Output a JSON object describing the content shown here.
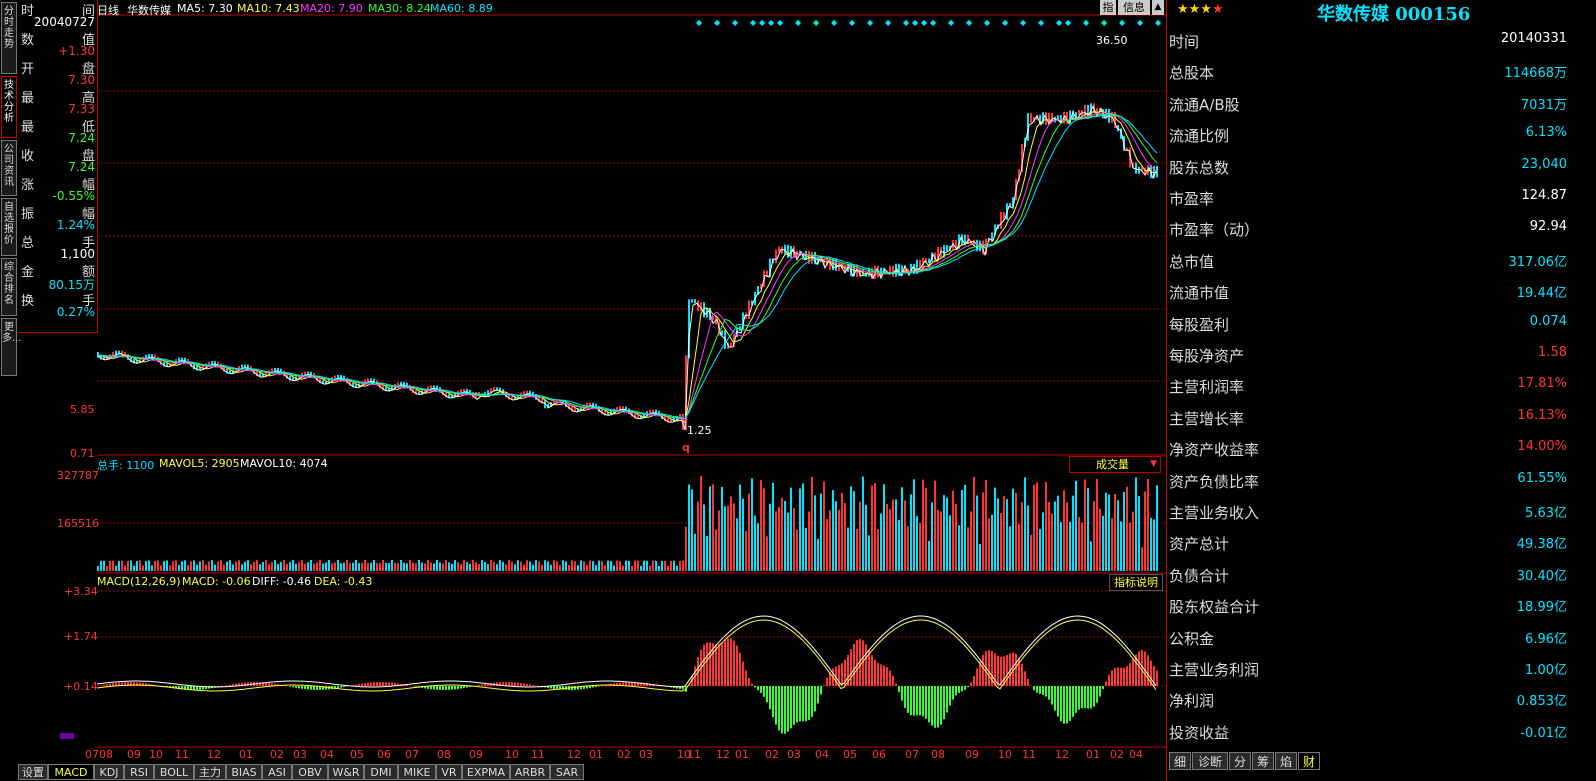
{
  "left_tabs": [
    "分时走势",
    "技术分析",
    "公司资讯",
    "自选报价",
    "综合排名",
    "更多..."
  ],
  "info": {
    "rows": [
      {
        "label": "时",
        "label2": "间",
        "value": "20040727",
        "color": "#ffffff"
      },
      {
        "label": "数",
        "label2": "值",
        "value": "+1.30",
        "color": "#ff3333"
      },
      {
        "label": "开",
        "label2": "盘",
        "value": "7.30",
        "color": "#ff3333"
      },
      {
        "label": "最",
        "label2": "高",
        "value": "7.33",
        "color": "#ff3333"
      },
      {
        "label": "最",
        "label2": "低",
        "value": "7.24",
        "color": "#33ff33"
      },
      {
        "label": "收",
        "label2": "盘",
        "value": "7.24",
        "color": "#33ff33"
      },
      {
        "label": "涨",
        "label2": "幅",
        "value": "-0.55%",
        "color": "#33ff33"
      },
      {
        "label": "振",
        "label2": "幅",
        "value": "1.24%",
        "color": "#00e5ff"
      },
      {
        "label": "总",
        "label2": "手",
        "value": "1,100",
        "color": "#ffffff"
      },
      {
        "label": "金",
        "label2": "额",
        "value": "80.15万",
        "color": "#00e5ff"
      },
      {
        "label": "换",
        "label2": "手",
        "value": "0.27%",
        "color": "#00e5ff"
      }
    ]
  },
  "header": {
    "period": "日线",
    "name": "华数传媒",
    "ma": [
      {
        "text": "MA5: 7.30",
        "color": "#ffffff"
      },
      {
        "text": "MA10: 7.43",
        "color": "#ffff33"
      },
      {
        "text": "MA20: 7.90",
        "color": "#ff33ff"
      },
      {
        "text": "MA30: 8.24",
        "color": "#33ff33"
      },
      {
        "text": "MA60: 8.89",
        "color": "#00e5ff"
      }
    ],
    "btn_ref": "指",
    "btn_info": "信息"
  },
  "price_axis": [
    "5.85",
    "0.71"
  ],
  "price_marks": {
    "high": "36.50",
    "low": "1.25",
    "q": "q"
  },
  "volume": {
    "label": "总手: 1100",
    "mavol5": "MAVOL5: 2905",
    "mavol10": "MAVOL10: 4074",
    "axis": [
      "327787",
      "165516"
    ],
    "select": "成交量"
  },
  "macd": {
    "label": "MACD(12,26,9)",
    "macd": "MACD: -0.06",
    "diff": "DIFF: -0.46",
    "dea": "DEA: -0.43",
    "axis": [
      "+3.34",
      "+1.74",
      "+0.14"
    ],
    "button": "指标说明"
  },
  "x_labels": [
    "07",
    "08",
    "09",
    "10",
    "11",
    "12",
    "01",
    "02",
    "03",
    "04",
    "05",
    "06",
    "07",
    "08",
    "09",
    "10",
    "11",
    "12",
    "01",
    "02",
    "03",
    "10",
    "11",
    "12",
    "01",
    "02",
    "03",
    "04",
    "05",
    "06",
    "07",
    "08",
    "09",
    "10",
    "11",
    "12",
    "01",
    "02",
    "04"
  ],
  "bottom_tabs": [
    "设置",
    "MACD",
    "KDJ",
    "RSI",
    "BOLL",
    "主力",
    "BIAS",
    "ASI",
    "OBV",
    "W&R",
    "DMI",
    "MIKE",
    "VR",
    "EXPMA",
    "ARBR",
    "SAR"
  ],
  "right": {
    "stars": "★★★",
    "star_red": "★",
    "title": "华数传媒 000156",
    "rows": [
      {
        "label": "时间",
        "value": "20140331",
        "color": "#ffffff"
      },
      {
        "label": "总股本",
        "value": "114668万",
        "color": "#00e5ff"
      },
      {
        "label": "流通A/B股",
        "value": "7031万",
        "color": "#00e5ff"
      },
      {
        "label": "流通比例",
        "value": "6.13%",
        "color": "#00e5ff"
      },
      {
        "label": "股东总数",
        "value": "23,040",
        "color": "#00e5ff"
      },
      {
        "label": "市盈率",
        "value": "124.87",
        "color": "#ffffff"
      },
      {
        "label": "市盈率（动）",
        "value": "92.94",
        "color": "#ffffff"
      },
      {
        "label": "总市值",
        "value": "317.06亿",
        "color": "#00e5ff"
      },
      {
        "label": "流通市值",
        "value": "19.44亿",
        "color": "#00e5ff"
      },
      {
        "label": "每股盈利",
        "value": "0.074",
        "color": "#00e5ff"
      },
      {
        "label": "每股净资产",
        "value": "1.58",
        "color": "#ff3333"
      },
      {
        "label": "主营利润率",
        "value": "17.81%",
        "color": "#ff3333"
      },
      {
        "label": "主营增长率",
        "value": "16.13%",
        "color": "#ff3333"
      },
      {
        "label": "净资产收益率",
        "value": "14.00%",
        "color": "#ff3333"
      },
      {
        "label": "资产负债比率",
        "value": "61.55%",
        "color": "#00e5ff"
      },
      {
        "label": "主营业务收入",
        "value": "5.63亿",
        "color": "#00e5ff"
      },
      {
        "label": "资产总计",
        "value": "49.38亿",
        "color": "#00e5ff"
      },
      {
        "label": "负债合计",
        "value": "30.40亿",
        "color": "#00e5ff"
      },
      {
        "label": "股东权益合计",
        "value": "18.99亿",
        "color": "#00e5ff"
      },
      {
        "label": "公积金",
        "value": "6.96亿",
        "color": "#00e5ff"
      },
      {
        "label": "主营业务利润",
        "value": "1.00亿",
        "color": "#00e5ff"
      },
      {
        "label": "净利润",
        "value": "0.853亿",
        "color": "#00e5ff"
      },
      {
        "label": "投资收益",
        "value": "-0.01亿",
        "color": "#00e5ff"
      }
    ],
    "tabs": [
      "细",
      "诊断",
      "分",
      "筹",
      "焰",
      "财"
    ]
  }
}
